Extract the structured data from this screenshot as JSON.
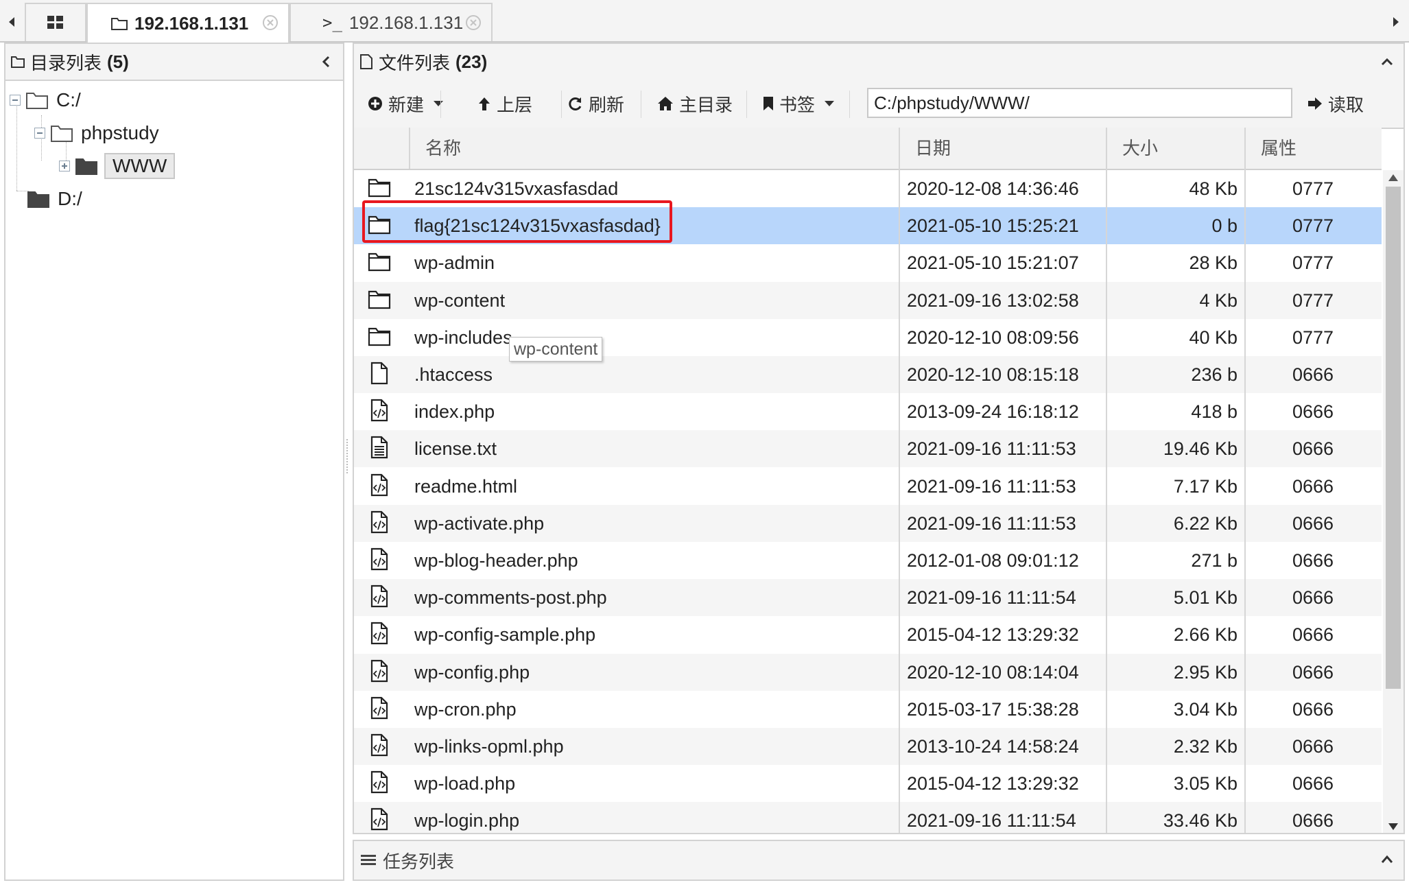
{
  "tabs": [
    {
      "label": "192.168.1.131",
      "kind": "folder-icon",
      "active": true
    },
    {
      "label": "192.168.1.131",
      "kind": "terminal-icon",
      "active": false
    }
  ],
  "left_pane": {
    "title": "目录列表",
    "count": "(5)",
    "tree": [
      "C:/",
      "phpstudy",
      "WWW",
      "D:/"
    ]
  },
  "right_pane": {
    "title": "文件列表",
    "count": "(23)",
    "toolbar": {
      "new_label": "新建",
      "up_label": "上层",
      "refresh_label": "刷新",
      "home_label": "主目录",
      "bookmark_label": "书签",
      "path": "C:/phpstudy/WWW/",
      "read_label": "读取"
    },
    "columns": {
      "name": "名称",
      "date": "日期",
      "size": "大小",
      "attr": "属性"
    },
    "files": [
      {
        "type": "folder",
        "name": "21sc124v315vxasfasdad",
        "date": "2020-12-08 14:36:46",
        "size": "48 Kb",
        "attr": "0777"
      },
      {
        "type": "folder",
        "name": "flag{21sc124v315vxasfasdad}",
        "date": "2021-05-10 15:25:21",
        "size": "0 b",
        "attr": "0777",
        "selected": true
      },
      {
        "type": "folder",
        "name": "wp-admin",
        "date": "2021-05-10 15:21:07",
        "size": "28 Kb",
        "attr": "0777"
      },
      {
        "type": "folder",
        "name": "wp-content",
        "date": "2021-09-16 13:02:58",
        "size": "4 Kb",
        "attr": "0777"
      },
      {
        "type": "folder",
        "name": "wp-includes",
        "date": "2020-12-10 08:09:56",
        "size": "40 Kb",
        "attr": "0777"
      },
      {
        "type": "file",
        "name": ".htaccess",
        "date": "2020-12-10 08:15:18",
        "size": "236 b",
        "attr": "0666"
      },
      {
        "type": "code",
        "name": "index.php",
        "date": "2013-09-24 16:18:12",
        "size": "418 b",
        "attr": "0666"
      },
      {
        "type": "text",
        "name": "license.txt",
        "date": "2021-09-16 11:11:53",
        "size": "19.46 Kb",
        "attr": "0666"
      },
      {
        "type": "code",
        "name": "readme.html",
        "date": "2021-09-16 11:11:53",
        "size": "7.17 Kb",
        "attr": "0666"
      },
      {
        "type": "code",
        "name": "wp-activate.php",
        "date": "2021-09-16 11:11:53",
        "size": "6.22 Kb",
        "attr": "0666"
      },
      {
        "type": "code",
        "name": "wp-blog-header.php",
        "date": "2012-01-08 09:01:12",
        "size": "271 b",
        "attr": "0666"
      },
      {
        "type": "code",
        "name": "wp-comments-post.php",
        "date": "2021-09-16 11:11:54",
        "size": "5.01 Kb",
        "attr": "0666"
      },
      {
        "type": "code",
        "name": "wp-config-sample.php",
        "date": "2015-04-12 13:29:32",
        "size": "2.66 Kb",
        "attr": "0666"
      },
      {
        "type": "code",
        "name": "wp-config.php",
        "date": "2020-12-10 08:14:04",
        "size": "2.95 Kb",
        "attr": "0666"
      },
      {
        "type": "code",
        "name": "wp-cron.php",
        "date": "2015-03-17 15:38:28",
        "size": "3.04 Kb",
        "attr": "0666"
      },
      {
        "type": "code",
        "name": "wp-links-opml.php",
        "date": "2013-10-24 14:58:24",
        "size": "2.32 Kb",
        "attr": "0666"
      },
      {
        "type": "code",
        "name": "wp-load.php",
        "date": "2015-04-12 13:29:32",
        "size": "3.05 Kb",
        "attr": "0666"
      },
      {
        "type": "code",
        "name": "wp-login.php",
        "date": "2021-09-16 11:11:54",
        "size": "33.46 Kb",
        "attr": "0666"
      }
    ],
    "tooltip": "wp-content"
  },
  "task_panel": {
    "label": "任务列表"
  },
  "colors": {
    "selected_row": "#b8d6fb",
    "highlight_box": "#e8171f"
  }
}
